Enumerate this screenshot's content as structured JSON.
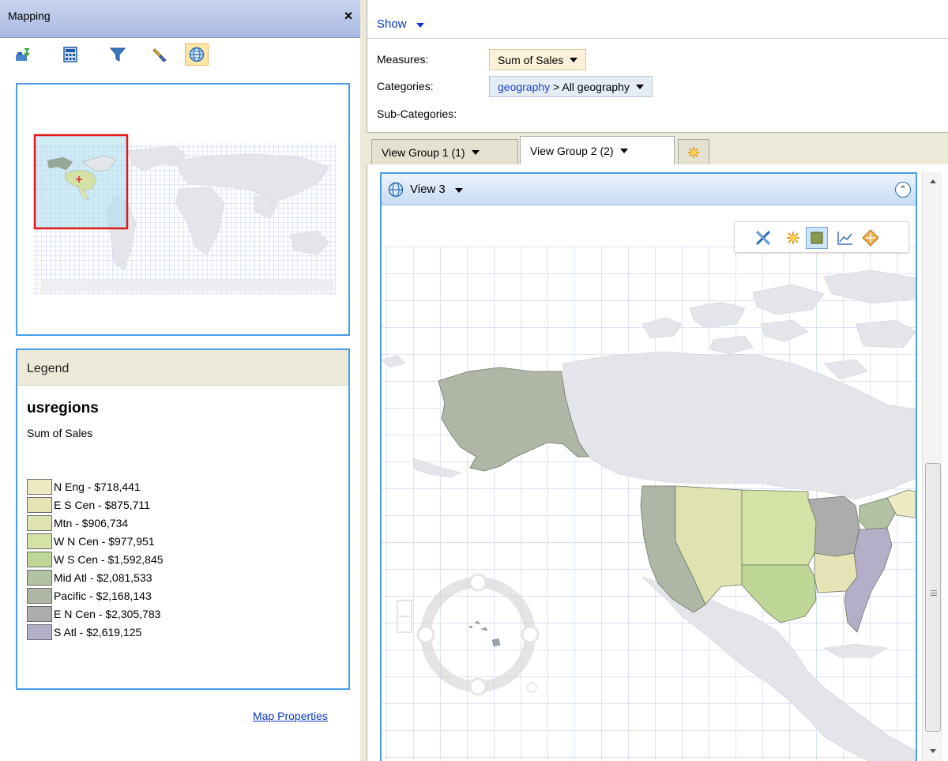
{
  "window": {
    "title": "Mapping",
    "close_label": "×"
  },
  "toolbar": {
    "tools": [
      {
        "icon": "import-data-icon"
      },
      {
        "icon": "calculator-icon"
      },
      {
        "icon": "filter-icon"
      },
      {
        "icon": "paint-brush-icon"
      },
      {
        "icon": "globe-icon",
        "active": true
      }
    ]
  },
  "legend": {
    "header": "Legend",
    "layer_name": "usregions",
    "measure": "Sum of Sales",
    "items": [
      {
        "label": "N Eng - $718,441",
        "color": "#eeeac3"
      },
      {
        "label": "E S Cen - $875,711",
        "color": "#e6e4b6"
      },
      {
        "label": "Mtn - $906,734",
        "color": "#dfe3b1"
      },
      {
        "label": "W N Cen - $977,951",
        "color": "#d4e2a5"
      },
      {
        "label": "W S Cen - $1,592,845",
        "color": "#bfd796"
      },
      {
        "label": "Mid Atl - $2,081,533",
        "color": "#b1c3a3"
      },
      {
        "label": "Pacific - $2,168,143",
        "color": "#b0b6a6"
      },
      {
        "label": "E N Cen - $2,305,783",
        "color": "#adacac"
      },
      {
        "label": "S Atl - $2,619,125",
        "color": "#b5aec8"
      }
    ]
  },
  "map_properties_link": "Map Properties",
  "pivot": {
    "show_label": "Show",
    "measures_label": "Measures:",
    "measures_value": "Sum of Sales",
    "categories_label": "Categories:",
    "categories_link": "geography",
    "categories_rest": " > All geography",
    "subcategories_label": "Sub-Categories:"
  },
  "tabs": [
    {
      "label": "View Group 1 (1)",
      "active": false
    },
    {
      "label": "View Group 2 (2)",
      "active": true
    }
  ],
  "view": {
    "title": "View 3",
    "map_tools": [
      "select-tool-icon",
      "burst-icon",
      "fill-icon",
      "line-chart-icon",
      "pan-diamond-icon"
    ]
  }
}
